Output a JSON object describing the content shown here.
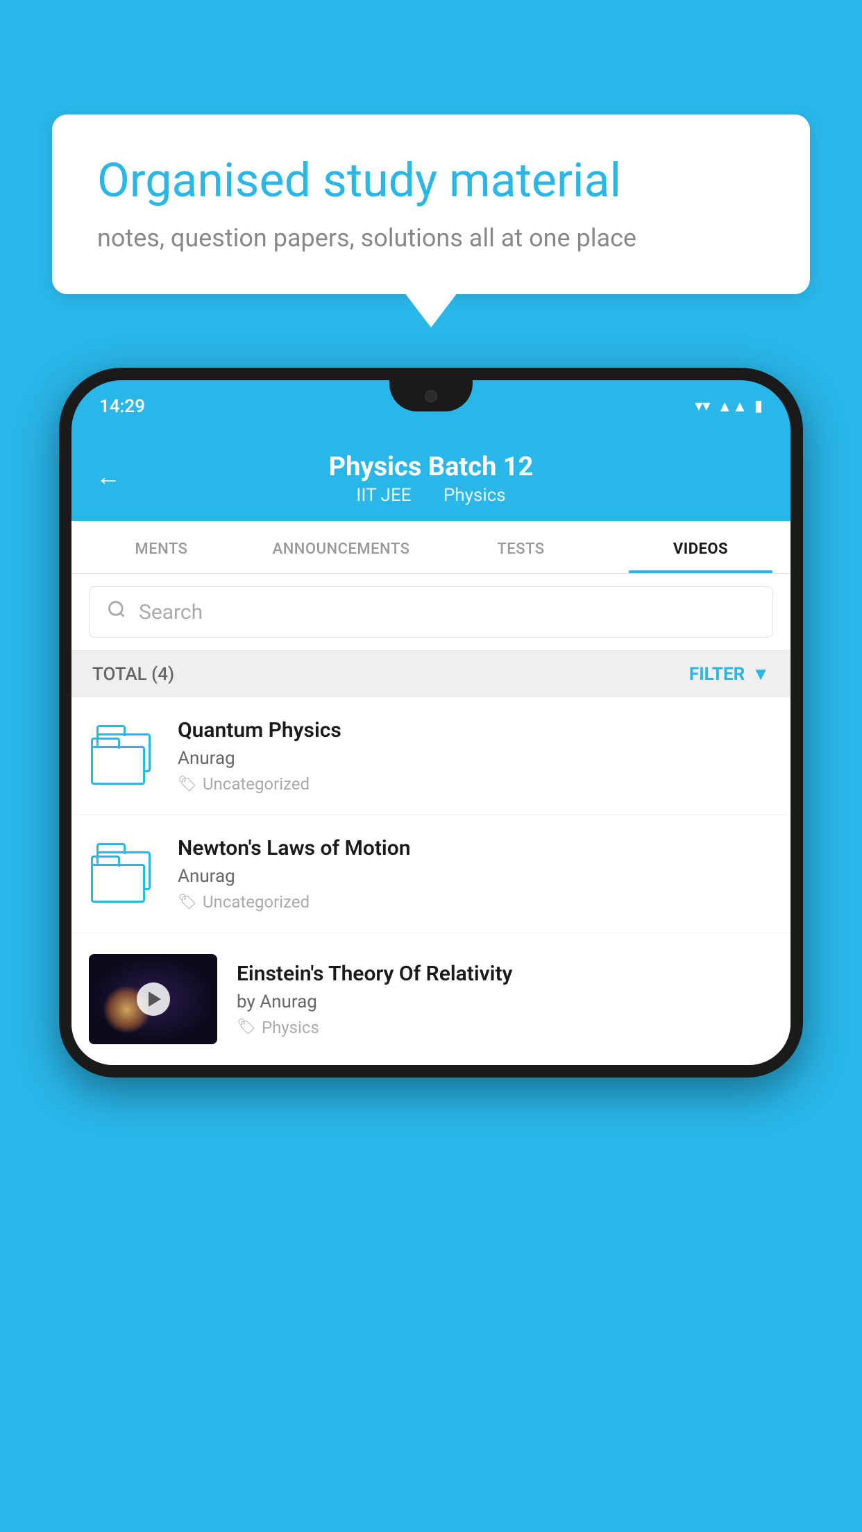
{
  "background": {
    "color": "#29B6E8"
  },
  "speech_bubble": {
    "title": "Organised study material",
    "subtitle": "notes, question papers, solutions all at one place"
  },
  "phone": {
    "status_bar": {
      "time": "14:29",
      "icons": [
        "wifi",
        "signal",
        "battery"
      ]
    },
    "header": {
      "back_label": "←",
      "title": "Physics Batch 12",
      "subtitle_parts": [
        "IIT JEE",
        "Physics"
      ]
    },
    "tabs": [
      {
        "label": "MENTS",
        "active": false
      },
      {
        "label": "ANNOUNCEMENTS",
        "active": false
      },
      {
        "label": "TESTS",
        "active": false
      },
      {
        "label": "VIDEOS",
        "active": true
      }
    ],
    "search": {
      "placeholder": "Search"
    },
    "filter": {
      "total_label": "TOTAL (4)",
      "filter_label": "FILTER"
    },
    "videos": [
      {
        "id": 1,
        "title": "Quantum Physics",
        "author": "Anurag",
        "tag": "Uncategorized",
        "has_thumbnail": false
      },
      {
        "id": 2,
        "title": "Newton's Laws of Motion",
        "author": "Anurag",
        "tag": "Uncategorized",
        "has_thumbnail": false
      },
      {
        "id": 3,
        "title": "Einstein's Theory Of Relativity",
        "author": "by Anurag",
        "tag": "Physics",
        "has_thumbnail": true
      }
    ]
  }
}
